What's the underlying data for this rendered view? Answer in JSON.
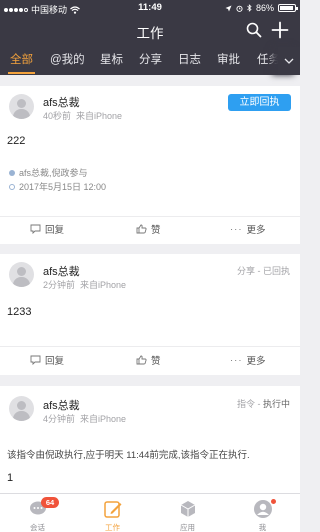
{
  "status_bar": {
    "carrier": "中国移动",
    "time": "11:49",
    "battery_pct": 86,
    "battery_label": "86%"
  },
  "header": {
    "title": "工作"
  },
  "tabs": [
    {
      "label": "全部",
      "active": true
    },
    {
      "label": "@我的",
      "active": false
    },
    {
      "label": "星标",
      "active": false
    },
    {
      "label": "分享",
      "active": false
    },
    {
      "label": "日志",
      "active": false
    },
    {
      "label": "审批",
      "active": false
    },
    {
      "label": "任务",
      "active": false
    }
  ],
  "posts": [
    {
      "author": "afs总裁",
      "time_ago": "40秒前",
      "source": "来自iPhone",
      "action_label": "立即回执",
      "content": "222",
      "participants": "afs总裁,倪政参与",
      "datetime": "2017年5月15日 12:00",
      "actions": {
        "reply": "回复",
        "like": "赞",
        "more": "更多"
      }
    },
    {
      "author": "afs总裁",
      "time_ago": "2分钟前",
      "source": "来自iPhone",
      "type_label": "分享",
      "sep": "-",
      "status_label": "已回执",
      "content": "1233",
      "actions": {
        "reply": "回复",
        "like": "赞",
        "more": "更多"
      }
    },
    {
      "author": "afs总裁",
      "time_ago": "4分钟前",
      "source": "来自iPhone",
      "type_label": "指令",
      "sep": "-",
      "status_label": "执行中",
      "content": "该指令由倪政执行,应于明天 11:44前完成,该指令正在执行.",
      "content2": "1"
    }
  ],
  "bottom_tabs": [
    {
      "label": "会话",
      "badge": "64",
      "active": false
    },
    {
      "label": "工作",
      "active": true
    },
    {
      "label": "应用",
      "active": false
    },
    {
      "label": "我",
      "dot": true,
      "active": false
    }
  ]
}
